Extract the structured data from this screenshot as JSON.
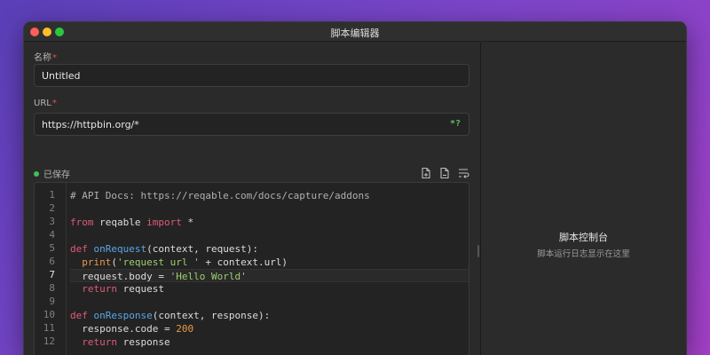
{
  "window": {
    "title": "脚本编辑器"
  },
  "form": {
    "name_label": "名称",
    "name_required_mark": "*",
    "name_value": "Untitled",
    "url_label": "URL",
    "url_required_mark": "*",
    "url_value": "https://httpbin.org/*",
    "url_regex_hint": "*?"
  },
  "status": {
    "text": "已保存",
    "color": "#3fbf5a"
  },
  "toolbar": {
    "icons": [
      "import-file-icon",
      "export-file-icon",
      "format-icon"
    ]
  },
  "editor": {
    "current_line": 7,
    "lines": [
      {
        "n": "1",
        "segs": [
          {
            "c": "cm",
            "t": "# API Docs: https://reqable.com/docs/capture/addons"
          }
        ]
      },
      {
        "n": "2",
        "segs": []
      },
      {
        "n": "3",
        "segs": [
          {
            "c": "kw",
            "t": "from"
          },
          {
            "c": "",
            "t": " reqable "
          },
          {
            "c": "kw",
            "t": "import"
          },
          {
            "c": "",
            "t": " *"
          }
        ]
      },
      {
        "n": "4",
        "segs": []
      },
      {
        "n": "5",
        "segs": [
          {
            "c": "kw",
            "t": "def"
          },
          {
            "c": "",
            "t": " "
          },
          {
            "c": "fn",
            "t": "onRequest"
          },
          {
            "c": "",
            "t": "(context, request):"
          }
        ]
      },
      {
        "n": "6",
        "segs": [
          {
            "c": "",
            "t": "  "
          },
          {
            "c": "nm",
            "t": "print"
          },
          {
            "c": "",
            "t": "("
          },
          {
            "c": "st",
            "t": "'request url '"
          },
          {
            "c": "",
            "t": " + context.url)"
          }
        ]
      },
      {
        "n": "7",
        "segs": [
          {
            "c": "",
            "t": "  request.body = "
          },
          {
            "c": "st",
            "t": "'Hello World'"
          }
        ]
      },
      {
        "n": "8",
        "segs": [
          {
            "c": "",
            "t": "  "
          },
          {
            "c": "kw",
            "t": "return"
          },
          {
            "c": "",
            "t": " request"
          }
        ]
      },
      {
        "n": "9",
        "segs": []
      },
      {
        "n": "10",
        "segs": [
          {
            "c": "kw",
            "t": "def"
          },
          {
            "c": "",
            "t": " "
          },
          {
            "c": "fn",
            "t": "onResponse"
          },
          {
            "c": "",
            "t": "(context, response):"
          }
        ]
      },
      {
        "n": "11",
        "segs": [
          {
            "c": "",
            "t": "  response.code = "
          },
          {
            "c": "nm",
            "t": "200"
          }
        ]
      },
      {
        "n": "12",
        "segs": [
          {
            "c": "",
            "t": "  "
          },
          {
            "c": "kw",
            "t": "return"
          },
          {
            "c": "",
            "t": " response"
          }
        ]
      }
    ]
  },
  "console": {
    "title": "脚本控制台",
    "subtitle": "脚本运行日志显示在这里"
  },
  "colors": {
    "keyword": "#e05a78",
    "function": "#5aa6e8",
    "string": "#9bcf6e",
    "number": "#e89a4a",
    "required": "#e0504a"
  }
}
